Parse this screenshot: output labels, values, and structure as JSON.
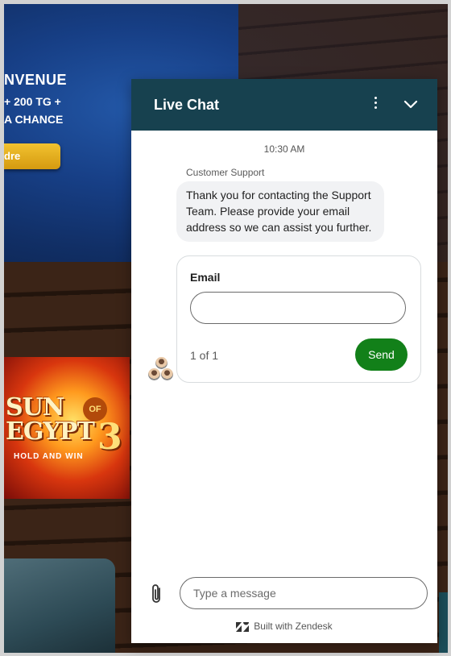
{
  "background": {
    "banner_title": "NVENUE",
    "banner_line1": "+ 200 TG +",
    "banner_line2": "A CHANCE",
    "banner_button": "dre",
    "game_tile": {
      "title_line1": "SUN",
      "title_of": "OF",
      "title_line2": "EGYPT",
      "number": "3",
      "subtitle": "HOLD AND WIN"
    }
  },
  "chat": {
    "title": "Live Chat",
    "timestamp": "10:30 AM",
    "sender": "Customer Support",
    "message": "Thank you for contacting the Support Team. Please provide your email address so we can assist you further.",
    "form": {
      "label": "Email",
      "value": "",
      "count": "1 of 1",
      "send_label": "Send"
    },
    "composer_placeholder": "Type a message",
    "footer": "Built with Zendesk"
  },
  "colors": {
    "header": "#17414f",
    "send_button": "#128019",
    "bubble": "#f1f2f4"
  },
  "icons": [
    "kebab-menu-icon",
    "chevron-down-icon",
    "paperclip-icon",
    "zendesk-logo-icon",
    "agent-avatars-icon"
  ]
}
